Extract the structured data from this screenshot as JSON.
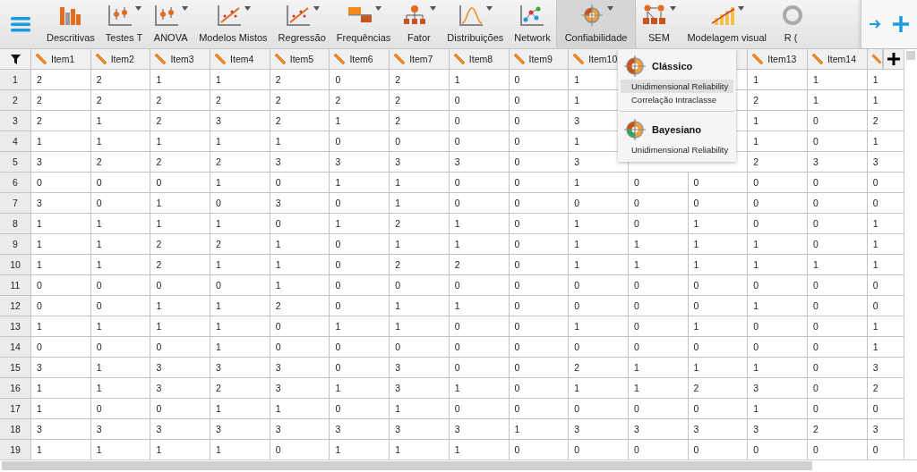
{
  "toolbar": {
    "modules": [
      {
        "label": "Descritivas",
        "selected": false,
        "has_menu": false
      },
      {
        "label": "Testes T",
        "selected": false,
        "has_menu": true
      },
      {
        "label": "ANOVA",
        "selected": false,
        "has_menu": true
      },
      {
        "label": "Modelos Mistos",
        "selected": false,
        "has_menu": true
      },
      {
        "label": "Regressão",
        "selected": false,
        "has_menu": true
      },
      {
        "label": "Frequências",
        "selected": false,
        "has_menu": true
      },
      {
        "label": "Fator",
        "selected": false,
        "has_menu": true
      },
      {
        "label": "Distribuições",
        "selected": false,
        "has_menu": true
      },
      {
        "label": "Network",
        "selected": false,
        "has_menu": false
      },
      {
        "label": "Confiabilidade",
        "selected": true,
        "has_menu": true
      },
      {
        "label": "SEM",
        "selected": false,
        "has_menu": true
      },
      {
        "label": "Modelagem visual",
        "selected": false,
        "has_menu": true
      },
      {
        "label": "R (",
        "selected": false,
        "has_menu": false
      }
    ]
  },
  "menu": {
    "sections": [
      {
        "title": "Clássico",
        "items": [
          {
            "label": "Unidimensional Reliability",
            "highlighted": true
          },
          {
            "label": "Correlação Intraclasse",
            "highlighted": false
          }
        ]
      },
      {
        "title": "Bayesiano",
        "items": [
          {
            "label": "Unidimensional Reliability",
            "highlighted": false
          }
        ]
      }
    ]
  },
  "table": {
    "columns": [
      {
        "label": "Item1"
      },
      {
        "label": "Item2"
      },
      {
        "label": "Item3"
      },
      {
        "label": "Item4"
      },
      {
        "label": "Item5"
      },
      {
        "label": "Item6"
      },
      {
        "label": "Item7"
      },
      {
        "label": "Item8"
      },
      {
        "label": "Item9"
      },
      {
        "label": "Item10"
      },
      null,
      null,
      {
        "label": "Item13"
      },
      {
        "label": "Item14"
      },
      {}
    ],
    "rows": [
      {
        "n": "1",
        "cells": [
          "2",
          "2",
          "1",
          "1",
          "2",
          "0",
          "2",
          "1",
          "0",
          "1",
          null,
          null,
          "1",
          "1",
          "1"
        ]
      },
      {
        "n": "2",
        "cells": [
          "2",
          "2",
          "2",
          "2",
          "2",
          "2",
          "2",
          "0",
          "0",
          "1",
          null,
          null,
          "2",
          "1",
          "1"
        ]
      },
      {
        "n": "3",
        "cells": [
          "2",
          "1",
          "2",
          "3",
          "2",
          "1",
          "2",
          "0",
          "0",
          "3",
          null,
          null,
          "1",
          "0",
          "2"
        ]
      },
      {
        "n": "4",
        "cells": [
          "1",
          "1",
          "1",
          "1",
          "1",
          "0",
          "0",
          "0",
          "0",
          "1",
          null,
          null,
          "1",
          "0",
          "1"
        ]
      },
      {
        "n": "5",
        "cells": [
          "3",
          "2",
          "2",
          "2",
          "3",
          "3",
          "3",
          "3",
          "0",
          "3",
          null,
          null,
          "2",
          "3",
          "3"
        ]
      },
      {
        "n": "6",
        "cells": [
          "0",
          "0",
          "0",
          "1",
          "0",
          "1",
          "1",
          "0",
          "0",
          "1",
          "0",
          "0",
          "0",
          "0",
          "0"
        ]
      },
      {
        "n": "7",
        "cells": [
          "3",
          "0",
          "1",
          "0",
          "3",
          "0",
          "1",
          "0",
          "0",
          "0",
          "0",
          "0",
          "0",
          "0",
          "0"
        ]
      },
      {
        "n": "8",
        "cells": [
          "1",
          "1",
          "1",
          "1",
          "0",
          "1",
          "2",
          "1",
          "0",
          "1",
          "0",
          "1",
          "0",
          "0",
          "1"
        ]
      },
      {
        "n": "9",
        "cells": [
          "1",
          "1",
          "2",
          "2",
          "1",
          "0",
          "1",
          "1",
          "0",
          "1",
          "1",
          "1",
          "1",
          "0",
          "1"
        ]
      },
      {
        "n": "10",
        "cells": [
          "1",
          "1",
          "2",
          "1",
          "1",
          "0",
          "2",
          "2",
          "0",
          "1",
          "1",
          "1",
          "1",
          "1",
          "1"
        ]
      },
      {
        "n": "11",
        "cells": [
          "0",
          "0",
          "0",
          "0",
          "1",
          "0",
          "0",
          "0",
          "0",
          "0",
          "0",
          "0",
          "0",
          "0",
          "0"
        ]
      },
      {
        "n": "12",
        "cells": [
          "0",
          "0",
          "1",
          "1",
          "2",
          "0",
          "1",
          "1",
          "0",
          "0",
          "0",
          "0",
          "1",
          "0",
          "0"
        ]
      },
      {
        "n": "13",
        "cells": [
          "1",
          "1",
          "1",
          "1",
          "0",
          "1",
          "1",
          "0",
          "0",
          "1",
          "0",
          "1",
          "0",
          "0",
          "1"
        ]
      },
      {
        "n": "14",
        "cells": [
          "0",
          "0",
          "0",
          "1",
          "0",
          "0",
          "0",
          "0",
          "0",
          "0",
          "0",
          "0",
          "0",
          "0",
          "1"
        ]
      },
      {
        "n": "15",
        "cells": [
          "3",
          "1",
          "3",
          "3",
          "3",
          "0",
          "3",
          "0",
          "0",
          "2",
          "1",
          "1",
          "1",
          "0",
          "3"
        ]
      },
      {
        "n": "16",
        "cells": [
          "1",
          "1",
          "3",
          "2",
          "3",
          "1",
          "3",
          "1",
          "0",
          "1",
          "1",
          "2",
          "3",
          "0",
          "2"
        ]
      },
      {
        "n": "17",
        "cells": [
          "1",
          "0",
          "0",
          "1",
          "1",
          "0",
          "1",
          "0",
          "0",
          "0",
          "0",
          "0",
          "1",
          "0",
          "0"
        ]
      },
      {
        "n": "18",
        "cells": [
          "3",
          "3",
          "3",
          "3",
          "3",
          "3",
          "3",
          "3",
          "1",
          "3",
          "3",
          "3",
          "3",
          "2",
          "3"
        ]
      },
      {
        "n": "19",
        "cells": [
          "1",
          "1",
          "1",
          "1",
          "0",
          "1",
          "1",
          "1",
          "0",
          "0",
          "0",
          "0",
          "0",
          "0",
          "0"
        ]
      }
    ]
  }
}
